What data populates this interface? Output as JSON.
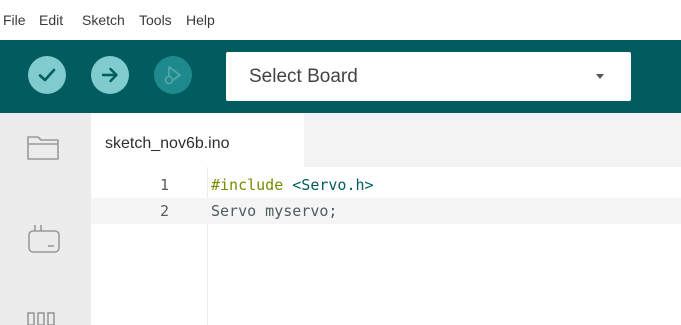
{
  "menubar": {
    "items": [
      "File",
      "Edit",
      "Sketch",
      "Tools",
      "Help"
    ]
  },
  "toolbar": {
    "verify_icon": "checkmark-icon",
    "upload_icon": "arrow-right-icon",
    "debug_icon": "debug-icon",
    "board_select": {
      "value": "Select Board",
      "caret_icon": "caret-down-icon"
    }
  },
  "sidebar": {
    "icons": [
      "folder-icon",
      "boards-icon",
      "library-icon"
    ]
  },
  "editor": {
    "tab": {
      "label": "sketch_nov6b.ino"
    },
    "lines": [
      {
        "number": "1",
        "directive": "#include",
        "space": " ",
        "target": "<Servo.h>"
      },
      {
        "number": "2",
        "code": "Servo myservo;"
      }
    ]
  },
  "colors": {
    "toolbar": "#005c5f",
    "toolbar_button": "#7fcbcd",
    "toolbar_button_disabled": "#1f8a8d",
    "directive": "#728e00",
    "include_target": "#005c5f"
  }
}
